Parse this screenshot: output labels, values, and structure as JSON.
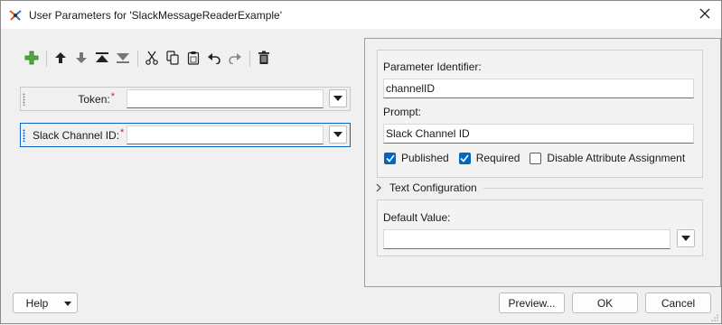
{
  "window": {
    "title": "User Parameters for 'SlackMessageReaderExample'",
    "close_icon": "close-icon",
    "app_icon": "workbench-app-icon"
  },
  "toolbar": {
    "items": [
      {
        "name": "add-parameter-button",
        "icon": "plus-icon"
      },
      {
        "name": "move-up-button",
        "icon": "arrow-up-icon"
      },
      {
        "name": "move-down-button",
        "icon": "arrow-down-icon"
      },
      {
        "name": "move-to-top-button",
        "icon": "move-top-icon"
      },
      {
        "name": "move-to-bottom-button",
        "icon": "move-bottom-icon"
      },
      {
        "name": "cut-button",
        "icon": "scissors-icon"
      },
      {
        "name": "copy-button",
        "icon": "copy-icon"
      },
      {
        "name": "paste-button",
        "icon": "clipboard-icon"
      },
      {
        "name": "undo-button",
        "icon": "undo-icon"
      },
      {
        "name": "redo-button",
        "icon": "redo-icon"
      },
      {
        "name": "delete-button",
        "icon": "trash-icon"
      }
    ]
  },
  "parameters": [
    {
      "label": "Token:",
      "required_mark": "*",
      "value": "",
      "selected": false
    },
    {
      "label": "Slack Channel ID:",
      "required_mark": "*",
      "value": "",
      "selected": true
    }
  ],
  "details": {
    "identifier_label": "Parameter Identifier:",
    "identifier_value": "channelID",
    "prompt_label": "Prompt:",
    "prompt_value": "Slack Channel ID",
    "published_label": "Published",
    "published_checked": true,
    "required_label": "Required",
    "required_checked": true,
    "disable_attr_label": "Disable Attribute Assignment",
    "disable_attr_checked": false,
    "text_config_label": "Text Configuration",
    "default_value_label": "Default Value:",
    "default_value": ""
  },
  "buttons": {
    "help": "Help",
    "preview": "Preview...",
    "ok": "OK",
    "cancel": "Cancel"
  },
  "colors": {
    "accent": "#0067c0",
    "selection_border": "#0a64c8",
    "required_star": "#d02020",
    "add_icon": "#3c9a2c"
  }
}
